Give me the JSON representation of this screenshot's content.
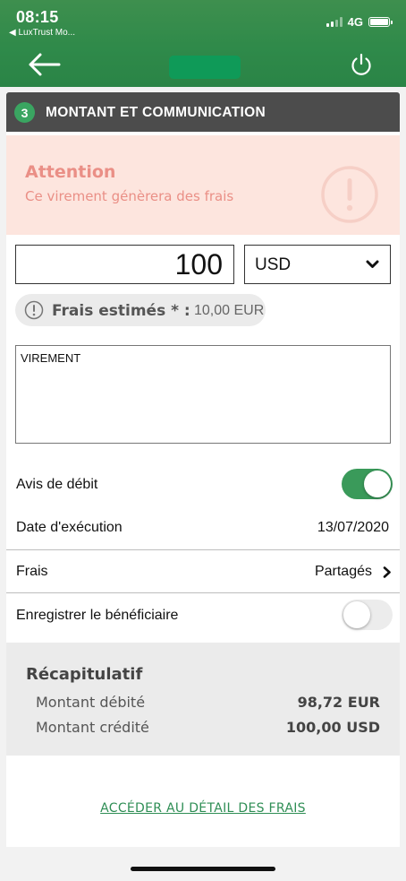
{
  "status_bar": {
    "time": "08:15",
    "back_app": "◀ LuxTrust Mo...",
    "network": "4G"
  },
  "nav": {
    "back_icon": "arrow-left-icon",
    "power_icon": "power-icon"
  },
  "section": {
    "step_number": "3",
    "title": "MONTANT ET COMMUNICATION"
  },
  "alert": {
    "title": "Attention",
    "text": "Ce virement génèrera des frais",
    "icon": "exclamation-circle-icon"
  },
  "amount": {
    "value": "100",
    "currency": "USD"
  },
  "fees": {
    "label": "Frais estimés * :",
    "value": "10,00 EUR"
  },
  "communication": {
    "value": "VIREMENT"
  },
  "options": {
    "debit_notice": {
      "label": "Avis de débit",
      "enabled": true
    },
    "execution_date": {
      "label": "Date d'exécution",
      "value": "13/07/2020"
    },
    "fees_mode": {
      "label": "Frais",
      "value": "Partagés"
    },
    "save_beneficiary": {
      "label": "Enregistrer le bénéficiaire",
      "enabled": false
    }
  },
  "summary": {
    "title": "Récapitulatif",
    "debited_label": "Montant débité",
    "debited_value": "98,72 EUR",
    "credited_label": "Montant crédité",
    "credited_value": "100,00 USD"
  },
  "link": {
    "fees_detail": "ACCÉDER AU DÉTAIL DES FRAIS"
  },
  "colors": {
    "brand_green": "#2f8a4a",
    "header_dark": "#4c4c4c",
    "alert_bg": "#fde5de",
    "alert_text": "#ea8f86",
    "toggle_on": "#3a9a5a"
  }
}
